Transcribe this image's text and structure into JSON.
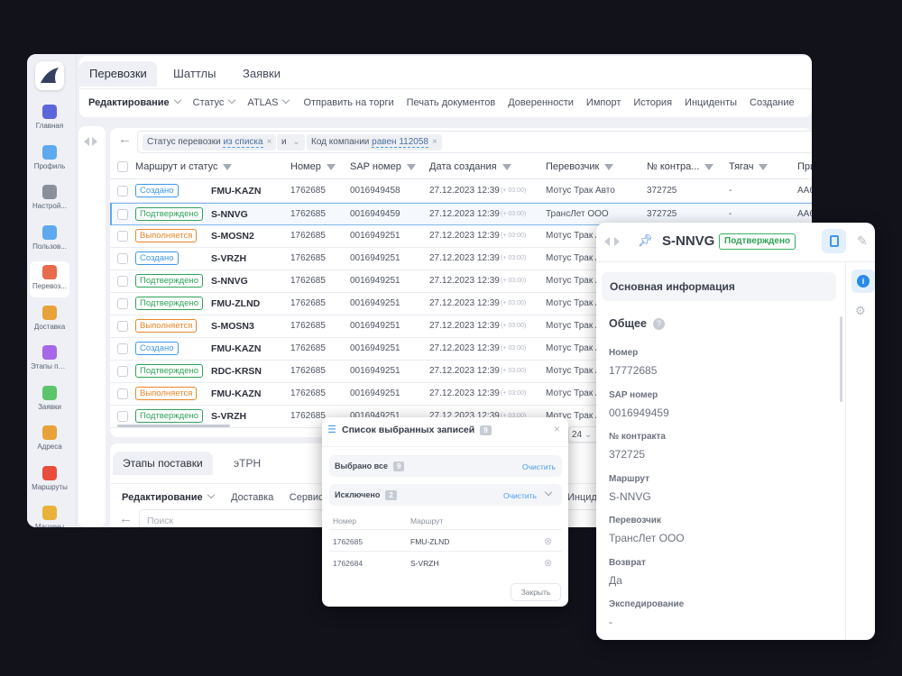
{
  "sidebar": {
    "items": [
      {
        "label": "Главная",
        "color": "#5b67d9"
      },
      {
        "label": "Профиль",
        "color": "#5ea9ee"
      },
      {
        "label": "Настрой...",
        "color": "#8a8f9c"
      },
      {
        "label": "Пользов...",
        "color": "#5ea9ee"
      },
      {
        "label": "Перевоз...",
        "color": "#e86a4c",
        "active": true
      },
      {
        "label": "Доставка",
        "color": "#e8a23a"
      },
      {
        "label": "Этапы пер...",
        "color": "#a468e8"
      },
      {
        "label": "Заявки",
        "color": "#5cc46a"
      },
      {
        "label": "Адреса",
        "color": "#e8a23a"
      },
      {
        "label": "Маршруты",
        "color": "#e84c3c"
      },
      {
        "label": "Машины",
        "color": "#e8b23a"
      }
    ]
  },
  "tabs": [
    "Перевозки",
    "Шаттлы",
    "Заявки"
  ],
  "toolbar": {
    "items": [
      "Редактирование",
      "Статус",
      "ATLAS",
      "Отправить на торги",
      "Печать документов",
      "Доверенности",
      "Импорт",
      "История",
      "Инциденты",
      "Создание"
    ]
  },
  "filter": {
    "chip1_label": "Статус перевозки",
    "chip1_op": "из списка",
    "connector": "и",
    "chip2_label": "Код компании",
    "chip2_op": "равен 112058"
  },
  "table": {
    "headers": [
      "Маршрут и статус",
      "Номер",
      "SAP номер",
      "Дата создания",
      "Перевозчик",
      "№ контра...",
      "Тягач",
      "При..."
    ],
    "rows": [
      {
        "status": "Создано",
        "route": "FMU-KAZN",
        "num": "1762685",
        "sap": "0016949458",
        "date": "27.12.2023 12:39",
        "tz": "(+ 03:00)",
        "carrier": "Мотус Трак Авто",
        "contract": "372725",
        "truck": "-",
        "trailer": "АА6"
      },
      {
        "status": "Подтверждено",
        "route": "S-NNVG",
        "num": "1762685",
        "sap": "0016949459",
        "date": "27.12.2023 12:39",
        "tz": "(+ 03:00)",
        "carrier": "ТрансЛет ООО",
        "contract": "372725",
        "truck": "-",
        "trailer": "АА6",
        "selected": true
      },
      {
        "status": "Выполняется",
        "route": "S-MOSN2",
        "num": "1762685",
        "sap": "0016949251",
        "date": "27.12.2023 12:39",
        "tz": "(+ 03:00)",
        "carrier": "Мотус Трак Авто"
      },
      {
        "status": "Создано",
        "route": "S-VRZH",
        "num": "1762685",
        "sap": "0016949251",
        "date": "27.12.2023 12:39",
        "tz": "(+ 03:00)",
        "carrier": "Мотус Трак Авто"
      },
      {
        "status": "Подтверждено",
        "route": "S-NNVG",
        "num": "1762685",
        "sap": "0016949251",
        "date": "27.12.2023 12:39",
        "tz": "(+ 03:00)",
        "carrier": "Мотус Трак Авто"
      },
      {
        "status": "Подтверждено",
        "route": "FMU-ZLND",
        "num": "1762685",
        "sap": "0016949251",
        "date": "27.12.2023 12:39",
        "tz": "(+ 03:00)",
        "carrier": "Мотус Трак Авто"
      },
      {
        "status": "Выполняется",
        "route": "S-MOSN3",
        "num": "1762685",
        "sap": "0016949251",
        "date": "27.12.2023 12:39",
        "tz": "(+ 03:00)",
        "carrier": "Мотус Трак Авто"
      },
      {
        "status": "Создано",
        "route": "FMU-KAZN",
        "num": "1762685",
        "sap": "0016949251",
        "date": "27.12.2023 12:39",
        "tz": "(+ 03:00)",
        "carrier": "Мотус Трак Авто"
      },
      {
        "status": "Подтверждено",
        "route": "RDC-KRSN",
        "num": "1762685",
        "sap": "0016949251",
        "date": "27.12.2023 12:39",
        "tz": "(+ 03:00)",
        "carrier": "Мотус Трак Авто"
      },
      {
        "status": "Выполняется",
        "route": "FMU-KAZN",
        "num": "1762685",
        "sap": "0016949251",
        "date": "27.12.2023 12:39",
        "tz": "(+ 03:00)",
        "carrier": "Мотус Трак Авто"
      },
      {
        "status": "Подтверждено",
        "route": "S-VRZH",
        "num": "1762685",
        "sap": "0016949251",
        "date": "27.12.2023 12:39",
        "tz": "(+ 03:00)",
        "carrier": "Мотус Трак Авто"
      }
    ],
    "page_size": "24"
  },
  "status_colors": {
    "Создано": "#3d97e8",
    "Подтверждено": "#2fa257",
    "Выполняется": "#e8862a"
  },
  "bottom": {
    "tabs": [
      "Этапы поставки",
      "эТРН"
    ],
    "toolbar": [
      "Редактирование",
      "Доставка",
      "Сервисные",
      "Инциденты"
    ],
    "search_placeholder": "Поиск"
  },
  "modal": {
    "title": "Список выбранных записей",
    "title_count": "9",
    "selected_all": "Выбрано все",
    "selected_count": "9",
    "clear": "Очистить",
    "excluded": "Исключено",
    "excluded_count": "2",
    "col_num": "Номер",
    "col_route": "Маршрут",
    "rows": [
      {
        "num": "1762685",
        "route": "FMU-ZLND"
      },
      {
        "num": "1762684",
        "route": "S-VRZH"
      }
    ],
    "close": "Закрыть"
  },
  "detail": {
    "route": "S-NNVG",
    "status": "Подтверждено",
    "section": "Основная информация",
    "group": "Общее",
    "fields": [
      {
        "label": "Номер",
        "value": "17772685"
      },
      {
        "label": "SAP номер",
        "value": "0016949459"
      },
      {
        "label": "№ контракта",
        "value": "372725"
      },
      {
        "label": "Маршрут",
        "value": "S-NNVG"
      },
      {
        "label": "Перевозчик",
        "value": "ТрансЛет ООО"
      },
      {
        "label": "Возврат",
        "value": "Да"
      },
      {
        "label": "Экспедирование",
        "value": "-"
      }
    ]
  }
}
